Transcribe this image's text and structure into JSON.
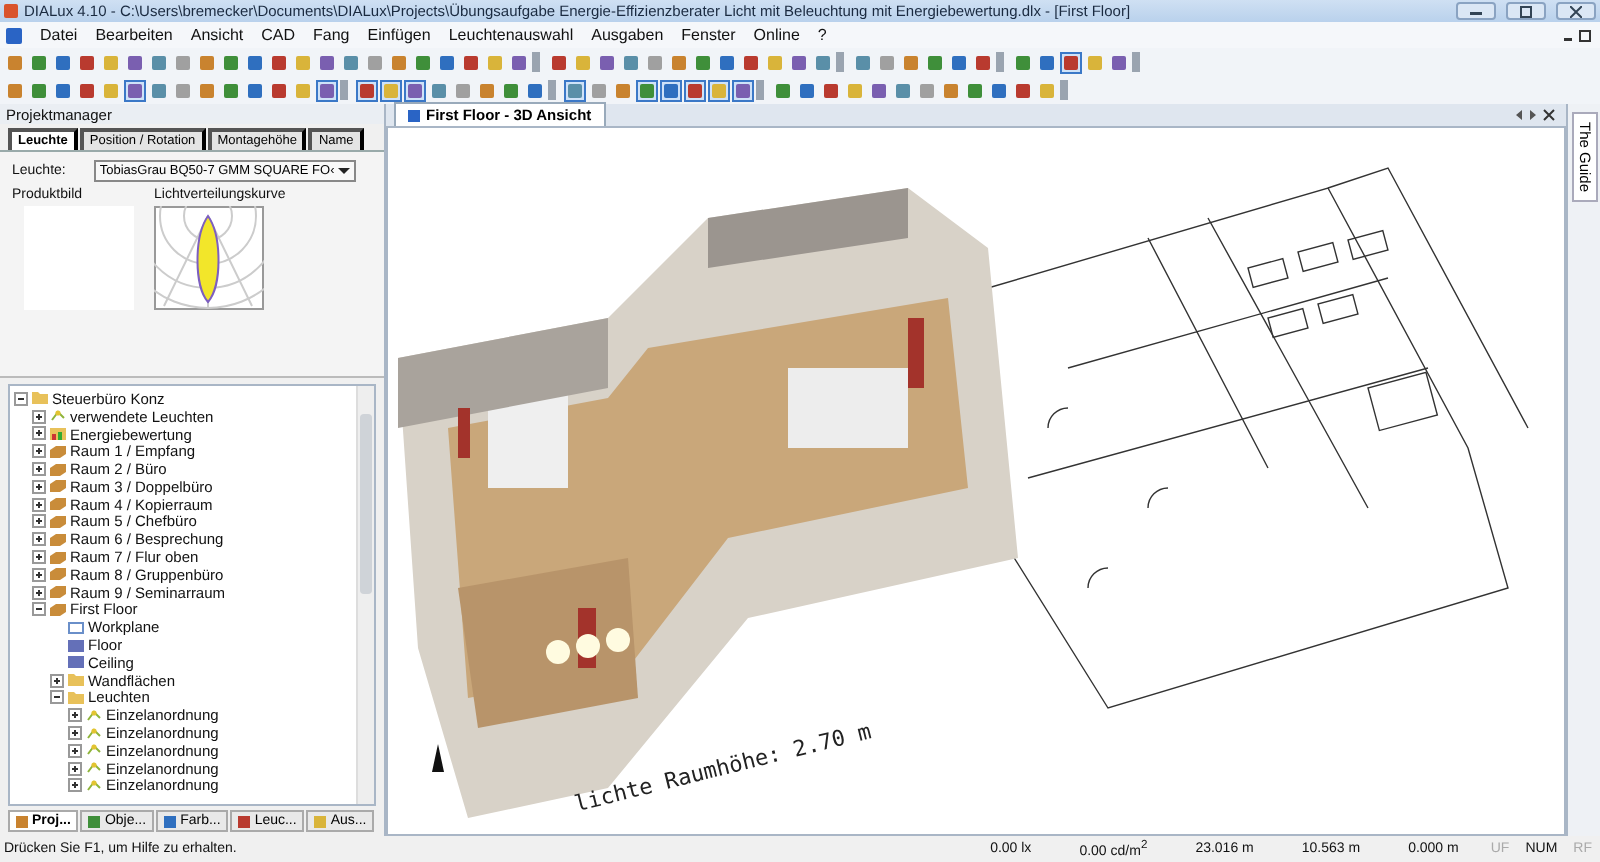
{
  "window": {
    "title": "DIALux 4.10 - C:\\Users\\bremecker\\Documents\\DIALux\\Projects\\Übungsaufgabe Energie-Effizienzberater Licht mit Beleuchtung mit Energiebewertung.dlx - [First Floor]"
  },
  "menu": [
    "Datei",
    "Bearbeiten",
    "Ansicht",
    "CAD",
    "Fang",
    "Einfügen",
    "Leuchtenauswahl",
    "Ausgaben",
    "Fenster",
    "Online",
    "?"
  ],
  "toolbars": [
    {
      "groups": [
        [
          {
            "pressed": false
          },
          {
            "pressed": false
          },
          {
            "pressed": false
          },
          {
            "pressed": false
          },
          {
            "pressed": false
          },
          {
            "pressed": false
          },
          {
            "pressed": false
          },
          {
            "pressed": false
          },
          {
            "pressed": false
          },
          {
            "pressed": false
          },
          {
            "pressed": false
          },
          {
            "pressed": false
          },
          {
            "pressed": false
          },
          {
            "pressed": false
          },
          {
            "pressed": false
          },
          {
            "pressed": false
          },
          {
            "pressed": false
          },
          {
            "pressed": false
          },
          {
            "pressed": false
          },
          {
            "pressed": false
          },
          {
            "pressed": false
          },
          {
            "pressed": false
          }
        ],
        [
          {
            "pressed": false
          },
          {
            "pressed": false
          },
          {
            "pressed": false
          },
          {
            "pressed": false
          },
          {
            "pressed": false
          },
          {
            "pressed": false
          },
          {
            "pressed": false
          },
          {
            "pressed": false
          },
          {
            "pressed": false
          },
          {
            "pressed": false
          },
          {
            "pressed": false
          },
          {
            "pressed": false
          }
        ],
        [
          {
            "pressed": false
          },
          {
            "pressed": false
          },
          {
            "pressed": false
          },
          {
            "pressed": false
          },
          {
            "pressed": false
          },
          {
            "pressed": false
          }
        ],
        [
          {
            "pressed": false
          },
          {
            "pressed": false
          },
          {
            "pressed": true
          },
          {
            "pressed": false
          },
          {
            "pressed": false
          }
        ]
      ]
    },
    {
      "groups": [
        [
          {
            "pressed": false
          },
          {
            "pressed": false
          },
          {
            "pressed": false
          },
          {
            "pressed": false
          },
          {
            "pressed": false
          },
          {
            "pressed": true
          },
          {
            "pressed": false
          },
          {
            "pressed": false
          },
          {
            "pressed": false
          },
          {
            "pressed": false
          },
          {
            "pressed": false
          },
          {
            "pressed": false
          },
          {
            "pressed": false
          },
          {
            "pressed": true
          }
        ],
        [
          {
            "pressed": true
          },
          {
            "pressed": true
          },
          {
            "pressed": true
          },
          {
            "pressed": false
          },
          {
            "pressed": false
          },
          {
            "pressed": false
          },
          {
            "pressed": false
          },
          {
            "pressed": false
          }
        ],
        [
          {
            "pressed": true
          },
          {
            "pressed": false
          },
          {
            "pressed": false
          },
          {
            "pressed": true
          },
          {
            "pressed": true
          },
          {
            "pressed": true
          },
          {
            "pressed": true
          },
          {
            "pressed": true
          }
        ],
        [
          {
            "pressed": false
          },
          {
            "pressed": false
          },
          {
            "pressed": false
          },
          {
            "pressed": false
          },
          {
            "pressed": false
          },
          {
            "pressed": false
          },
          {
            "pressed": false
          },
          {
            "pressed": false
          },
          {
            "pressed": false
          },
          {
            "pressed": false
          },
          {
            "pressed": false
          },
          {
            "pressed": false
          }
        ]
      ]
    }
  ],
  "project_manager": {
    "title": "Projektmanager",
    "tabs": [
      {
        "label": "Leuchte",
        "selected": true
      },
      {
        "label": "Position / Rotation",
        "selected": false
      },
      {
        "label": "Montagehöhe",
        "selected": false
      },
      {
        "label": "Name",
        "selected": false
      }
    ],
    "luminaire_label": "Leuchte:",
    "luminaire_value": "TobiasGrau BQ50-7 GMM SQUARE FO‹",
    "product_image_label": "Produktbild",
    "distribution_label": "Lichtverteilungskurve",
    "tree": [
      {
        "label": "Steuerbüro Konz",
        "kind": "folder",
        "expanded": true,
        "children": [
          {
            "label": "verwendete Leuchten",
            "kind": "luminaire",
            "expanded": false
          },
          {
            "label": "Energiebewertung",
            "kind": "energy",
            "expanded": false
          },
          {
            "label": "Raum 1 / Empfang",
            "kind": "room",
            "expanded": false
          },
          {
            "label": "Raum 2 / Büro",
            "kind": "room",
            "expanded": false
          },
          {
            "label": "Raum 3 / Doppelbüro",
            "kind": "room",
            "expanded": false
          },
          {
            "label": "Raum 4 / Kopierraum",
            "kind": "room",
            "expanded": false
          },
          {
            "label": "Raum 5 / Chefbüro",
            "kind": "room",
            "expanded": false
          },
          {
            "label": "Raum 6 / Besprechung",
            "kind": "room",
            "expanded": false
          },
          {
            "label": "Raum 7 / Flur oben",
            "kind": "room",
            "expanded": false
          },
          {
            "label": "Raum 8 / Gruppenbüro",
            "kind": "room",
            "expanded": false
          },
          {
            "label": "Raum 9 / Seminarraum",
            "kind": "room",
            "expanded": false
          },
          {
            "label": "First Floor",
            "kind": "room",
            "expanded": true,
            "children": [
              {
                "label": "Workplane",
                "kind": "workplane"
              },
              {
                "label": "Floor",
                "kind": "surface"
              },
              {
                "label": "Ceiling",
                "kind": "surface"
              },
              {
                "label": "Wandflächen",
                "kind": "folder",
                "expanded": false
              },
              {
                "label": "Leuchten",
                "kind": "folder",
                "expanded": true,
                "children": [
                  {
                    "label": "Einzelanordnung",
                    "kind": "luminaire",
                    "expanded": false
                  },
                  {
                    "label": "Einzelanordnung",
                    "kind": "luminaire",
                    "expanded": false
                  },
                  {
                    "label": "Einzelanordnung",
                    "kind": "luminaire",
                    "expanded": false
                  },
                  {
                    "label": "Einzelanordnung",
                    "kind": "luminaire",
                    "expanded": false
                  },
                  {
                    "label": "Einzelanordnung",
                    "kind": "luminaire",
                    "expanded": false
                  }
                ]
              }
            ]
          }
        ]
      }
    ],
    "bottom_tabs": [
      {
        "label": "Proj...",
        "selected": true
      },
      {
        "label": "Obje...",
        "selected": false
      },
      {
        "label": "Farb...",
        "selected": false
      },
      {
        "label": "Leuc...",
        "selected": false
      },
      {
        "label": "Aus...",
        "selected": false
      }
    ]
  },
  "document": {
    "tab": {
      "label": "First Floor - 3D Ansicht",
      "selected": true
    },
    "ceiling_height_label": "lichte Raumhöhe: 2.70 m"
  },
  "side_panel": {
    "label": "The Guide"
  },
  "status_bar": {
    "message": "Drücken Sie F1, um Hilfe zu erhalten.",
    "readings": [
      "0.00 lx",
      "0.00 cd/m$^{2}$",
      "23.016 m",
      "10.563 m",
      "0.000 m"
    ],
    "indicators": [
      {
        "label": "UF",
        "on": false
      },
      {
        "label": "NUM",
        "on": true
      },
      {
        "label": "RF",
        "on": false
      }
    ]
  }
}
